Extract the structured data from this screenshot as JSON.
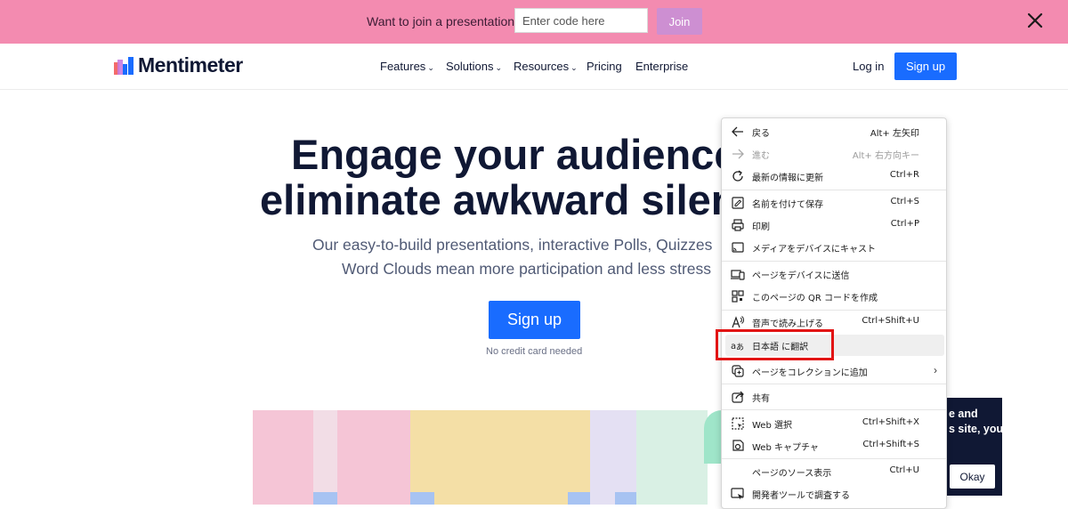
{
  "banner": {
    "prompt": "Want to join a presentation?",
    "code_placeholder": "Enter code here",
    "join_label": "Join"
  },
  "nav": {
    "brand": "Mentimeter",
    "items": [
      {
        "label": "Features",
        "dropdown": true
      },
      {
        "label": "Solutions",
        "dropdown": true
      },
      {
        "label": "Resources",
        "dropdown": true
      },
      {
        "label": "Pricing",
        "dropdown": false
      },
      {
        "label": "Enterprise",
        "dropdown": false
      }
    ],
    "login": "Log in",
    "signup": "Sign up"
  },
  "hero": {
    "title_line1": "Engage your audience",
    "title_line2": "eliminate awkward silen",
    "subtitle_line1": "Our easy-to-build presentations, interactive Polls, Quizzes",
    "subtitle_line2": "Word Clouds mean more participation and less stress",
    "cta": "Sign up",
    "note": "No credit card needed"
  },
  "cookie": {
    "line1": "e and",
    "line2": "s site, you",
    "ok": "Okay"
  },
  "context_menu": {
    "items": [
      {
        "label": "戻る",
        "shortcut": "Alt+ 左矢印",
        "icon": "back-arrow-icon"
      },
      {
        "label": "進む",
        "shortcut": "Alt+ 右方向キー",
        "icon": "forward-arrow-icon",
        "disabled": true
      },
      {
        "label": "最新の情報に更新",
        "shortcut": "Ctrl+R",
        "icon": "refresh-icon"
      },
      {
        "label": "名前を付けて保存",
        "shortcut": "Ctrl+S",
        "icon": "save-as-icon"
      },
      {
        "label": "印刷",
        "shortcut": "Ctrl+P",
        "icon": "print-icon"
      },
      {
        "label": "メディアをデバイスにキャスト",
        "shortcut": "",
        "icon": "cast-icon"
      },
      {
        "label": "ページをデバイスに送信",
        "shortcut": "",
        "icon": "send-to-device-icon"
      },
      {
        "label": "このページの QR コードを作成",
        "shortcut": "",
        "icon": "qr-code-icon"
      },
      {
        "label": "音声で読み上げる",
        "shortcut": "Ctrl+Shift+U",
        "icon": "read-aloud-icon"
      },
      {
        "label": "日本語 に翻訳",
        "shortcut": "",
        "icon": "translate-icon"
      },
      {
        "label": "ページをコレクションに追加",
        "shortcut": "",
        "icon": "collections-icon",
        "submenu": true
      },
      {
        "label": "共有",
        "shortcut": "",
        "icon": "share-icon"
      },
      {
        "label": "Web 選択",
        "shortcut": "Ctrl+Shift+X",
        "icon": "web-select-icon"
      },
      {
        "label": "Web キャプチャ",
        "shortcut": "Ctrl+Shift+S",
        "icon": "web-capture-icon"
      },
      {
        "label": "ページのソース表示",
        "shortcut": "Ctrl+U",
        "icon": ""
      },
      {
        "label": "開発者ツールで調査する",
        "shortcut": "",
        "icon": "dev-tools-icon"
      }
    ]
  },
  "colors": {
    "banner": "#f38bb0",
    "primary": "#196cff",
    "join": "#cd8fd2",
    "text_dark": "#101834",
    "highlight_box": "#e21414"
  }
}
